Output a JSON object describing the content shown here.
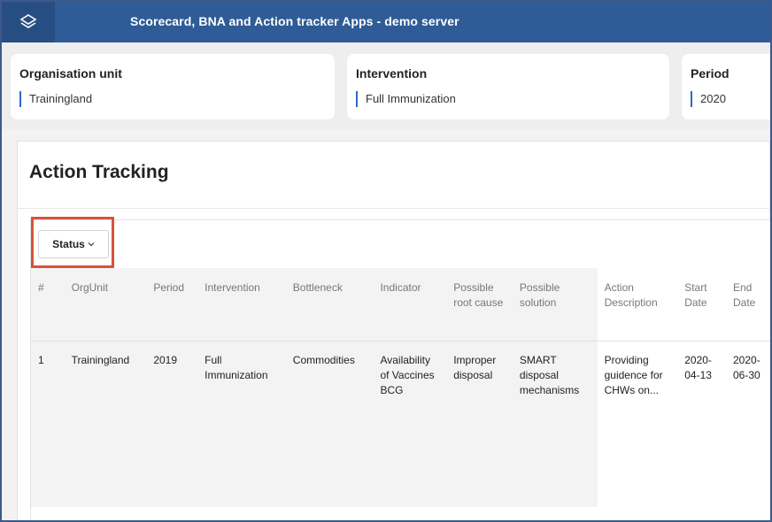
{
  "header": {
    "title": "Scorecard, BNA and Action tracker Apps - demo server",
    "logo_icon": "layers-icon"
  },
  "filters": {
    "org_unit": {
      "label": "Organisation unit",
      "value": "Trainingland"
    },
    "intervention": {
      "label": "Intervention",
      "value": "Full Immunization"
    },
    "period": {
      "label": "Period",
      "value": "2020"
    }
  },
  "panel": {
    "title": "Action Tracking"
  },
  "status_filter": {
    "label": "Status",
    "icon": "chevron-down-icon"
  },
  "table": {
    "columns": [
      "#",
      "OrgUnit",
      "Period",
      "Intervention",
      "Bottleneck",
      "Indicator",
      "Possible root cause",
      "Possible solution",
      "Action Description",
      "Start Date",
      "End Date"
    ],
    "rows": [
      [
        "1",
        "Trainingland",
        "2019",
        "Full Immunization",
        "Commodities",
        "Availability of Vaccines BCG",
        "Improper disposal",
        "SMART disposal mechanisms",
        "Providing guidence for CHWs on...",
        "2020-04-13",
        "2020-06-30"
      ]
    ]
  },
  "colors": {
    "topbar": "#2f5c96",
    "highlight": "#d6533b",
    "accent": "#2f6ac6"
  }
}
